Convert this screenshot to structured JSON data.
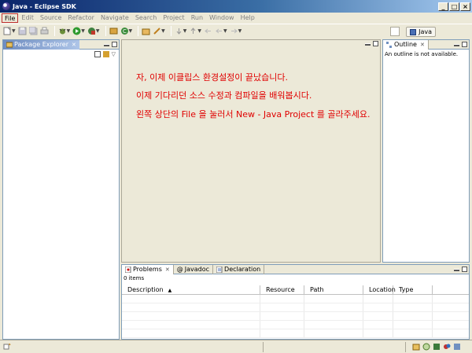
{
  "window": {
    "title": "Java - Eclipse SDK"
  },
  "menu": [
    "File",
    "Edit",
    "Source",
    "Refactor",
    "Navigate",
    "Search",
    "Project",
    "Run",
    "Window",
    "Help"
  ],
  "perspective": {
    "label": "Java"
  },
  "package_explorer": {
    "tab_label": "Package Explorer"
  },
  "outline": {
    "tab_label": "Outline",
    "message": "An outline is not available."
  },
  "editor": {
    "lines": [
      "자, 이제 이클립스 환경설정이 끝났습니다.",
      "이제 기다리던 소스 수정과 컴파일을 배워봅시다.",
      "왼쪽 상단의 File 을 눌러서 New - Java Project 를 골라주세요."
    ],
    "text_color": "#e00000"
  },
  "bottom": {
    "tabs": [
      "Problems",
      "Javadoc",
      "Declaration"
    ],
    "items_count": "0 items",
    "columns": [
      "Description",
      "Resource",
      "Path",
      "Location",
      "Type"
    ]
  },
  "colors": {
    "title_start": "#0a246a",
    "title_end": "#a6caf0",
    "chrome": "#ece9d8",
    "panel_border": "#7f9db9"
  }
}
